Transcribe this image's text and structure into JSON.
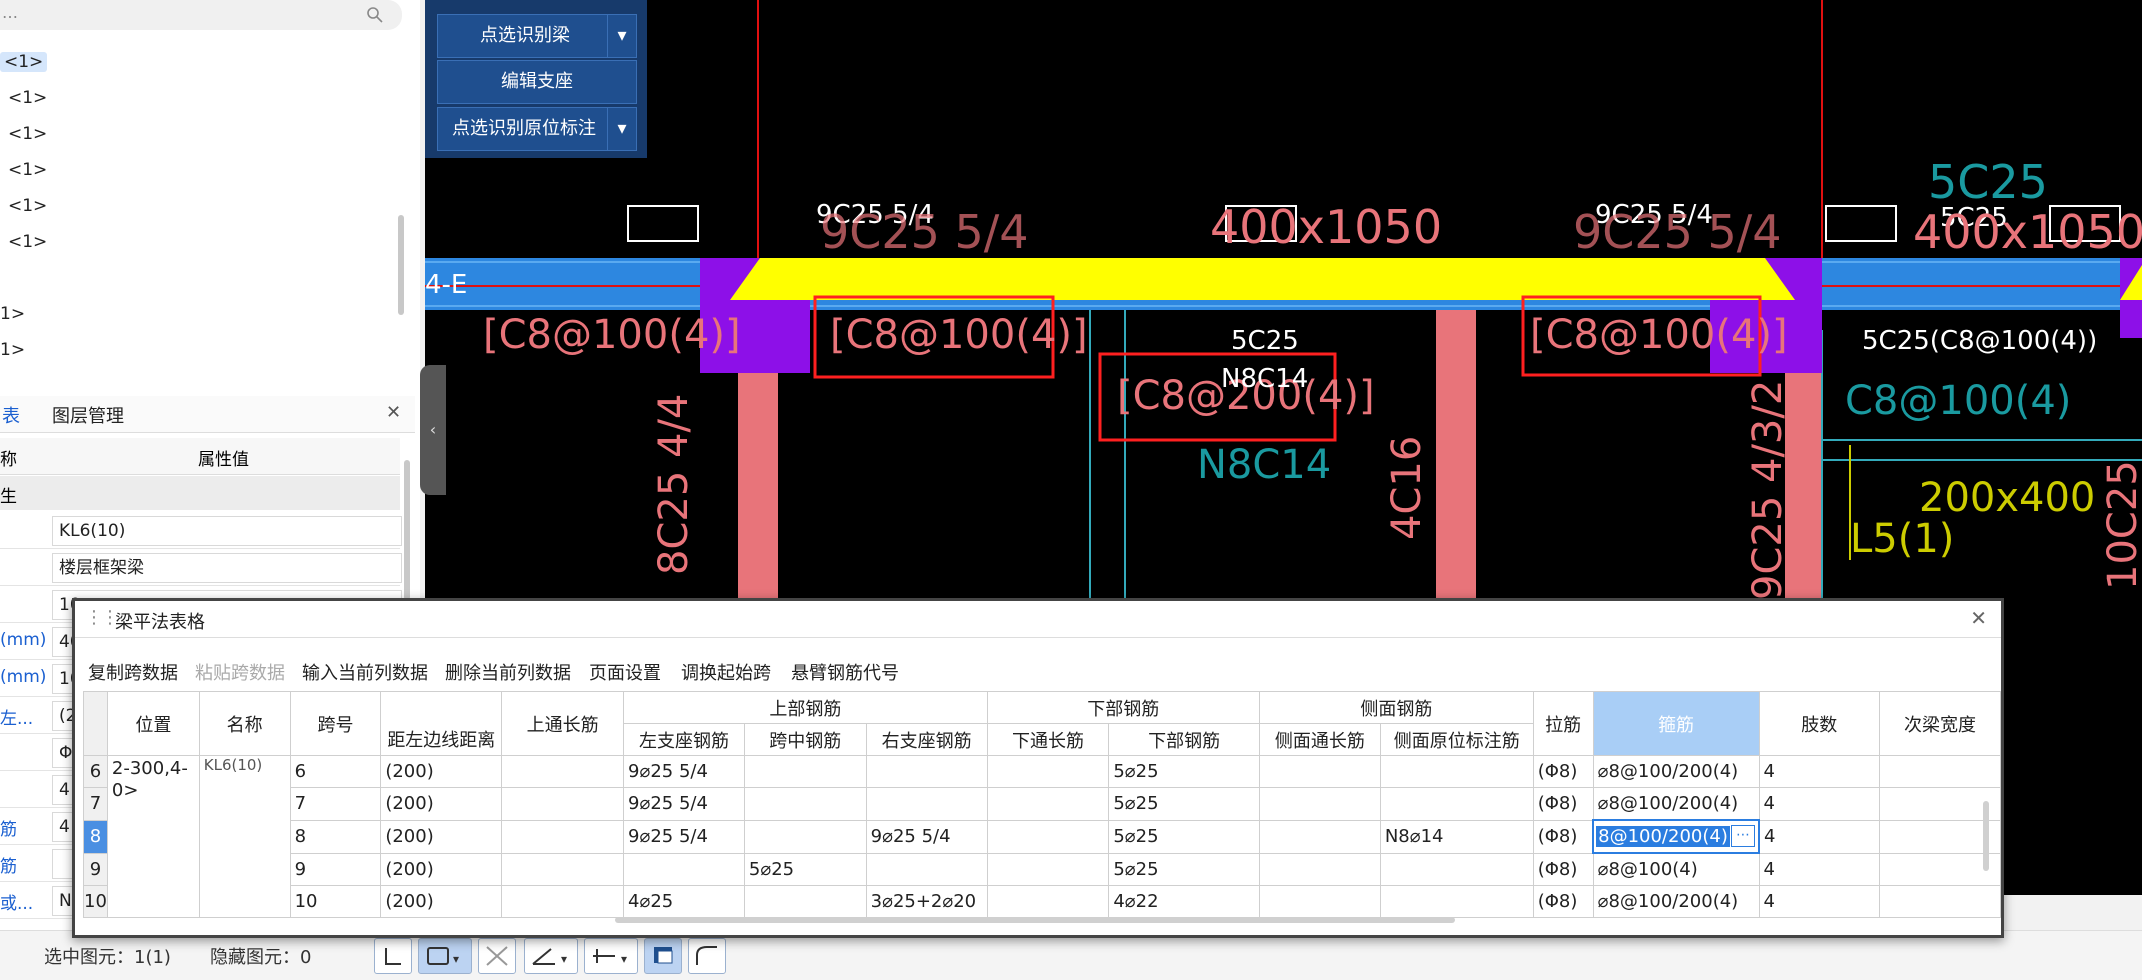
{
  "left": {
    "search_placeholder": "…",
    "tree": [
      "<1>",
      "<1>",
      "<1>",
      "<1>",
      "<1>",
      "<1>",
      "1>",
      "1>"
    ],
    "tabs": {
      "list": "表",
      "layer": "图层管理"
    },
    "prop_header": {
      "name": "称",
      "value": "属性值"
    },
    "prop_section": "生",
    "props": [
      {
        "label": "",
        "value": "KL6(10)"
      },
      {
        "label": "",
        "value": "楼层框架梁"
      },
      {
        "label": "",
        "value": "10"
      },
      {
        "label": "(mm)",
        "value": "40"
      },
      {
        "label": "(mm)",
        "value": "10"
      },
      {
        "label": "左...",
        "value": "(2"
      },
      {
        "label": "",
        "value": "Φ"
      },
      {
        "label": "",
        "value": "4"
      },
      {
        "label": "筋",
        "value": "4"
      },
      {
        "label": "筋",
        "value": ""
      },
      {
        "label": "或...",
        "value": "N"
      }
    ]
  },
  "cad": {
    "buttons": [
      {
        "label": "点选识别梁",
        "dropdown": true
      },
      {
        "label": "编辑支座",
        "dropdown": false
      },
      {
        "label": "点选识别原位标注",
        "dropdown": true
      }
    ],
    "texts": {
      "axis": "4-E",
      "t1": "9C25 5/4",
      "t2": "9C25 5/4",
      "t3": "400x1050",
      "t4": "9C25 5/4",
      "t5": "9C25 5/4",
      "t6": "5C25",
      "t7": "5C25",
      "t8": "400x1050",
      "s1": "[C8@100(4)]",
      "s2": "[C8@100(4)]",
      "s3": "[C8@200(4)]",
      "s4": "[C8@100(4)]",
      "s5": "5C25(C8@100(4))",
      "s6": "C8@100(4)",
      "m1": "5C25",
      "m2": "N8C14",
      "m3": "N8C14",
      "v1": "8C25 4/4",
      "v2": "4C16",
      "v3": "9C25 4/3/2",
      "v4": "10C25",
      "l1": "200x400",
      "l2": "L5(1)"
    }
  },
  "status": {
    "selected": "选中图元：1(1)",
    "hidden": "隐藏图元：0"
  },
  "dialog": {
    "title": "梁平法表格",
    "menu": [
      "复制跨数据",
      "粘贴跨数据",
      "输入当前列数据",
      "删除当前列数据",
      "页面设置",
      "调换起始跨",
      "悬臂钢筋代号"
    ],
    "headers": {
      "position": "位置",
      "name": "名称",
      "span": "跨号",
      "dist": "距左边线距离",
      "top_through": "上通长筋",
      "top_group": "上部钢筋",
      "top_left": "左支座钢筋",
      "top_mid": "跨中钢筋",
      "top_right": "右支座钢筋",
      "bot_group": "下部钢筋",
      "bot_through": "下通长筋",
      "bot": "下部钢筋",
      "side_group": "侧面钢筋",
      "side_through": "侧面通长筋",
      "side_orig": "侧面原位标注筋",
      "tie": "拉筋",
      "stirrup": "箍筋",
      "legs": "肢数",
      "sec_width": "次梁宽度"
    },
    "position_value": "2-300,4-0>",
    "name_value": "KL6(10)",
    "rows": [
      {
        "rn": "6",
        "span": "6",
        "dist": "(200)",
        "left": "9⌀25 5/4",
        "mid": "",
        "right": "",
        "bot": "5⌀25",
        "side": "",
        "tie": "(Φ8)",
        "stirrup": "⌀8@100/200(4)",
        "legs": "4"
      },
      {
        "rn": "7",
        "span": "7",
        "dist": "(200)",
        "left": "9⌀25 5/4",
        "mid": "",
        "right": "",
        "bot": "5⌀25",
        "side": "",
        "tie": "(Φ8)",
        "stirrup": "⌀8@100/200(4)",
        "legs": "4"
      },
      {
        "rn": "8",
        "span": "8",
        "dist": "(200)",
        "left": "9⌀25 5/4",
        "mid": "",
        "right": "9⌀25 5/4",
        "bot": "5⌀25",
        "side": "N8⌀14",
        "tie": "(Φ8)",
        "stirrup": "8@100/200(4)",
        "legs": "4"
      },
      {
        "rn": "9",
        "span": "9",
        "dist": "(200)",
        "left": "",
        "mid": "5⌀25",
        "right": "",
        "bot": "5⌀25",
        "side": "",
        "tie": "(Φ8)",
        "stirrup": "⌀8@100(4)",
        "legs": "4"
      },
      {
        "rn": "10",
        "span": "10",
        "dist": "(200)",
        "left": "4⌀25",
        "mid": "",
        "right": "3⌀25+2⌀20",
        "bot": "4⌀22",
        "side": "",
        "tie": "(Φ8)",
        "stirrup": "⌀8@100/200(4)",
        "legs": "4"
      }
    ],
    "edit_btn": "⋯"
  }
}
